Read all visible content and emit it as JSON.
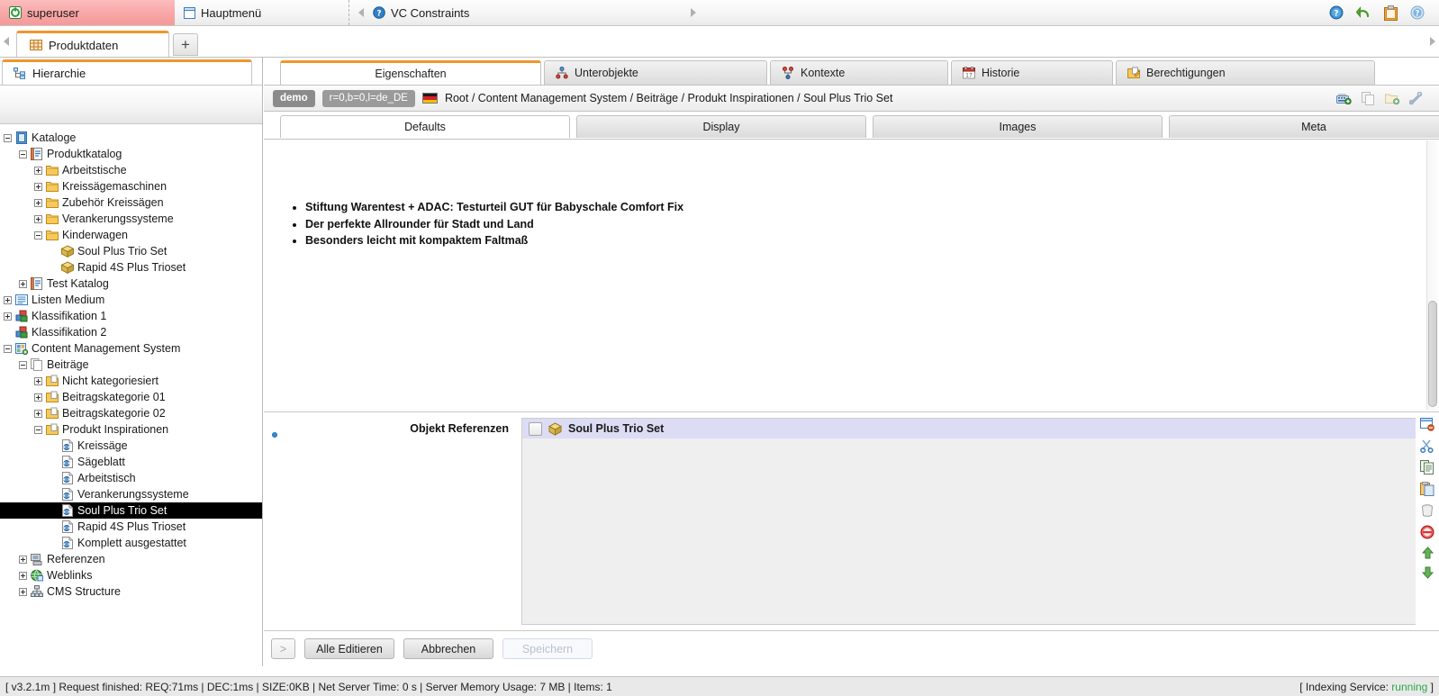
{
  "topbar": {
    "user": {
      "label": "superuser",
      "icon": "user-status-icon"
    },
    "menu": {
      "label": "Hauptmenü",
      "icon": "window-icon"
    },
    "vc": {
      "label": "VC Constraints",
      "icon": "info-icon"
    },
    "icons": [
      {
        "name": "help-blue-icon",
        "glyph": "?"
      },
      {
        "name": "undo-green-icon",
        "glyph": "↩"
      },
      {
        "name": "clipboard-orange-icon",
        "glyph": ""
      },
      {
        "name": "help-light-icon",
        "glyph": "?"
      }
    ]
  },
  "window_tabs": {
    "tabs": [
      {
        "label": "Produktdaten",
        "icon": "grid-icon",
        "active": true
      }
    ],
    "add_label": "+"
  },
  "sidebar": {
    "tab_label": "Hierarchie",
    "tab_icon": "hierarchy-icon",
    "tree": [
      {
        "label": "Kataloge",
        "depth": 0,
        "exp": "minus",
        "icon": "book-blue",
        "sel": false
      },
      {
        "label": "Produktkatalog",
        "depth": 1,
        "exp": "minus",
        "icon": "catalog",
        "sel": false
      },
      {
        "label": "Arbeitstische",
        "depth": 2,
        "exp": "plus",
        "icon": "folder",
        "sel": false
      },
      {
        "label": "Kreissägemaschinen",
        "depth": 2,
        "exp": "plus",
        "icon": "folder",
        "sel": false
      },
      {
        "label": "Zubehör Kreissägen",
        "depth": 2,
        "exp": "plus",
        "icon": "folder",
        "sel": false
      },
      {
        "label": "Verankerungssysteme",
        "depth": 2,
        "exp": "plus",
        "icon": "folder",
        "sel": false
      },
      {
        "label": "Kinderwagen",
        "depth": 2,
        "exp": "minus",
        "icon": "folder",
        "sel": false
      },
      {
        "label": "Soul Plus Trio Set",
        "depth": 3,
        "exp": "none",
        "icon": "package",
        "sel": false
      },
      {
        "label": "Rapid 4S Plus Trioset",
        "depth": 3,
        "exp": "none",
        "icon": "package",
        "sel": false
      },
      {
        "label": "Test Katalog",
        "depth": 1,
        "exp": "plus",
        "icon": "catalog",
        "sel": false
      },
      {
        "label": "Listen Medium",
        "depth": 0,
        "exp": "plus",
        "icon": "list",
        "sel": false
      },
      {
        "label": "Klassifikation 1",
        "depth": 0,
        "exp": "plus",
        "icon": "classif",
        "sel": false
      },
      {
        "label": "Klassifikation 2",
        "depth": 0,
        "exp": "none",
        "icon": "classif",
        "sel": false
      },
      {
        "label": "Content Management System",
        "depth": 0,
        "exp": "minus",
        "icon": "cms",
        "sel": false
      },
      {
        "label": "Beiträge",
        "depth": 1,
        "exp": "minus",
        "icon": "docs",
        "sel": false
      },
      {
        "label": "Nicht kategoriesiert",
        "depth": 2,
        "exp": "plus",
        "icon": "folder-doc",
        "sel": false
      },
      {
        "label": "Beitragskategorie 01",
        "depth": 2,
        "exp": "plus",
        "icon": "folder-doc",
        "sel": false
      },
      {
        "label": "Beitragskategorie 02",
        "depth": 2,
        "exp": "plus",
        "icon": "folder-doc",
        "sel": false
      },
      {
        "label": "Produkt Inspirationen",
        "depth": 2,
        "exp": "minus",
        "icon": "folder-doc",
        "sel": false
      },
      {
        "label": "Kreissäge",
        "depth": 3,
        "exp": "none",
        "icon": "article",
        "sel": false
      },
      {
        "label": "Sägeblatt",
        "depth": 3,
        "exp": "none",
        "icon": "article",
        "sel": false
      },
      {
        "label": "Arbeitstisch",
        "depth": 3,
        "exp": "none",
        "icon": "article",
        "sel": false
      },
      {
        "label": "Verankerungssysteme",
        "depth": 3,
        "exp": "none",
        "icon": "article",
        "sel": false
      },
      {
        "label": "Soul Plus Trio Set",
        "depth": 3,
        "exp": "none",
        "icon": "article",
        "sel": true
      },
      {
        "label": "Rapid 4S Plus Trioset",
        "depth": 3,
        "exp": "none",
        "icon": "article",
        "sel": false
      },
      {
        "label": "Komplett ausgestattet",
        "depth": 3,
        "exp": "none",
        "icon": "article",
        "sel": false
      },
      {
        "label": "Referenzen",
        "depth": 1,
        "exp": "plus",
        "icon": "refs",
        "sel": false
      },
      {
        "label": "Weblinks",
        "depth": 1,
        "exp": "plus",
        "icon": "weblink",
        "sel": false
      },
      {
        "label": "CMS Structure",
        "depth": 1,
        "exp": "plus",
        "icon": "structure",
        "sel": false
      }
    ]
  },
  "main": {
    "tabs": [
      {
        "label": "Eigenschaften",
        "icon": "",
        "active": true
      },
      {
        "label": "Unterobjekte",
        "icon": "subobjects-icon",
        "active": false
      },
      {
        "label": "Kontexte",
        "icon": "contexts-icon",
        "active": false
      },
      {
        "label": "Historie",
        "icon": "calendar-icon",
        "active": false
      },
      {
        "label": "Berechtigungen",
        "icon": "permissions-icon",
        "active": false
      }
    ],
    "breadcrumb": {
      "chip_workspace": "demo",
      "chip_context": "r=0,b=0,l=de_DE",
      "flag_icon": "flag-de-icon",
      "path": "Root / Content Management System / Beiträge / Produkt Inspirationen / Soul Plus Trio Set"
    },
    "breadcrumb_icons": [
      {
        "name": "add-keyboard-icon"
      },
      {
        "name": "copy-icon"
      },
      {
        "name": "add-folder-icon"
      },
      {
        "name": "tools-icon"
      }
    ],
    "sub_tabs": [
      {
        "label": "Defaults",
        "active": true
      },
      {
        "label": "Display",
        "active": false
      },
      {
        "label": "Images",
        "active": false
      },
      {
        "label": "Meta",
        "active": false
      }
    ],
    "editor": {
      "bullets": [
        "Stiftung Warentest + ADAC: Testurteil GUT für Babyschale Comfort Fix",
        "Der perfekte Allrounder für Stadt und Land",
        "Besonders leicht mit kompaktem Faltmaß"
      ]
    },
    "references": {
      "label": "Objekt Referenzen",
      "rows": [
        {
          "name": "Soul Plus Trio Set",
          "icon": "package-icon",
          "checked": false,
          "selected": true
        }
      ],
      "tools": [
        {
          "name": "remove-window-icon"
        },
        {
          "name": "cut-scissors-icon"
        },
        {
          "name": "copy-icon"
        },
        {
          "name": "paste-icon"
        },
        {
          "name": "trash-icon"
        },
        {
          "name": "block-delete-icon"
        },
        {
          "name": "move-up-icon"
        },
        {
          "name": "move-down-icon"
        }
      ]
    },
    "buttons": {
      "expand": ">",
      "edit_all": "Alle Editieren",
      "cancel": "Abbrechen",
      "save": "Speichern"
    }
  },
  "statusbar": {
    "left": "[ v3.2.1m ] Request finished: REQ:71ms | DEC:1ms | SIZE:0KB | Net Server Time: 0 s | Server Memory Usage: 7 MB | Items: 1",
    "right_prefix": "[ Indexing Service: ",
    "right_value": "running",
    "right_suffix": " ]"
  },
  "colors": {
    "accent_orange": "#f0962d",
    "user_pink": "#f8a6a6",
    "selection_black": "#000000",
    "row_selected": "#dcdcf5",
    "status_running": "#2aa84a"
  }
}
